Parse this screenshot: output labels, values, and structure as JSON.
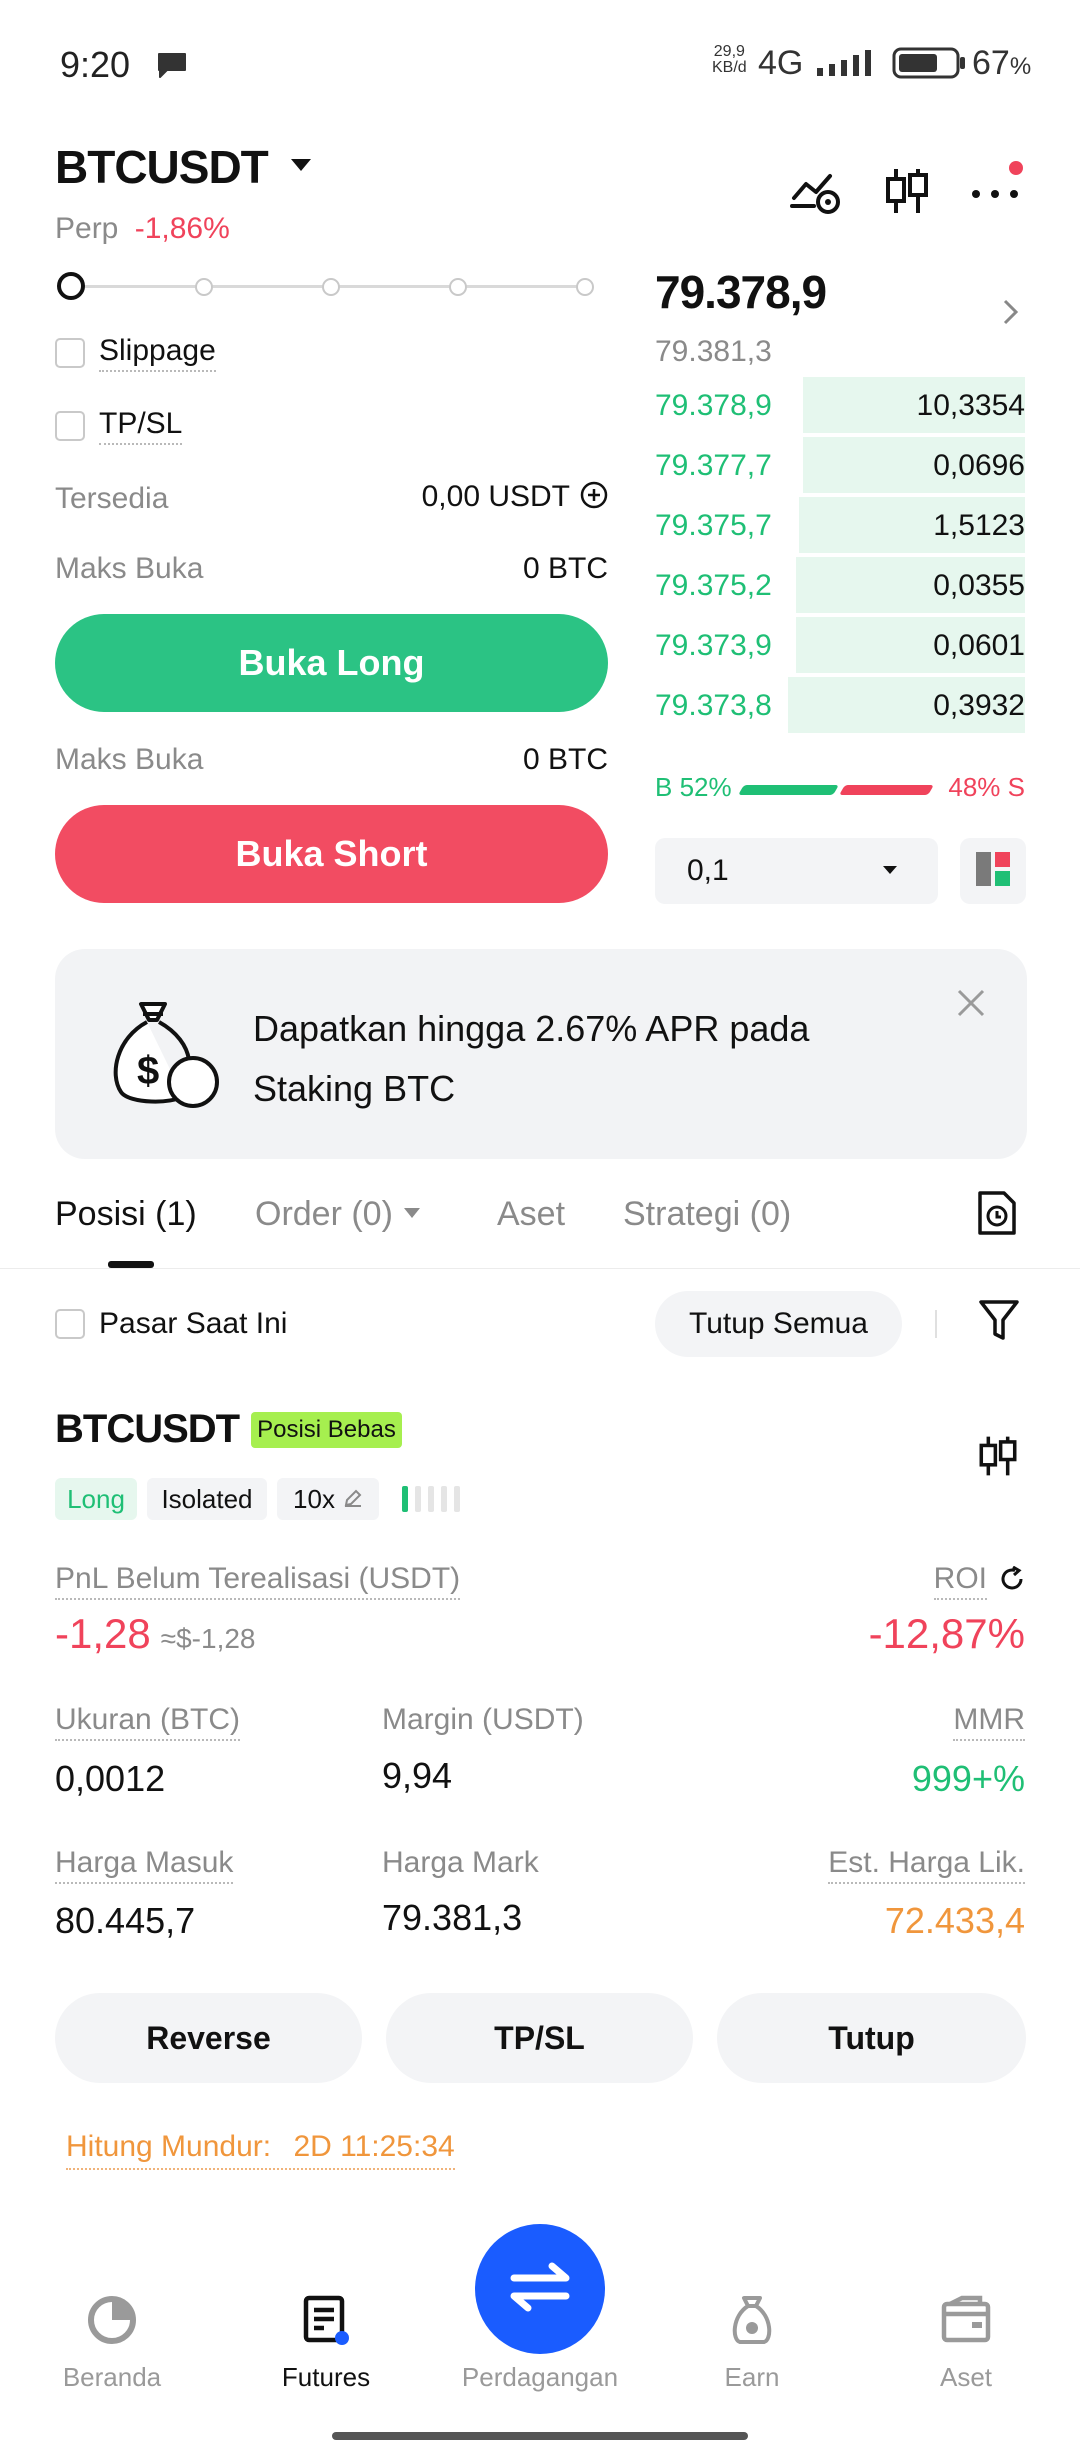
{
  "status_bar": {
    "time": "9:20",
    "net_speed_top": "29,9",
    "net_speed_bottom": "KB/d",
    "network": "4G",
    "battery": "67",
    "battery_unit": "%"
  },
  "header": {
    "symbol": "BTCUSDT",
    "perp_label": "Perp",
    "change": "-1,86%"
  },
  "order_form": {
    "slider_level": 0,
    "slippage_label": "Slippage",
    "tpsl_label": "TP/SL",
    "available_label": "Tersedia",
    "available_value": "0,00 USDT",
    "max_open_label_1": "Maks Buka",
    "max_open_value_1": "0 BTC",
    "long_button": "Buka Long",
    "max_open_label_2": "Maks Buka",
    "max_open_value_2": "0 BTC",
    "short_button": "Buka Short"
  },
  "orderbook": {
    "last_price": "79.378,9",
    "mark_price": "79.381,3",
    "rows": [
      {
        "price": "79.378,9",
        "qty": "10,3354",
        "depth": 0.6
      },
      {
        "price": "79.377,7",
        "qty": "0,0696",
        "depth": 0.6
      },
      {
        "price": "79.375,7",
        "qty": "1,5123",
        "depth": 0.61
      },
      {
        "price": "79.375,2",
        "qty": "0,0355",
        "depth": 0.62
      },
      {
        "price": "79.373,9",
        "qty": "0,0601",
        "depth": 0.62
      },
      {
        "price": "79.373,8",
        "qty": "0,3932",
        "depth": 0.64
      }
    ],
    "buy_ratio": "B 52%",
    "sell_ratio": "48% S",
    "buy_fraction": 0.52,
    "precision": "0,1"
  },
  "banner": {
    "text_line1": "Dapatkan hingga 2.67% APR pada",
    "text_line2": "Staking BTC"
  },
  "tabs": {
    "positions": "Posisi (1)",
    "orders": "Order (0)",
    "assets": "Aset",
    "strategies": "Strategi (0)"
  },
  "filters": {
    "current_market": "Pasar Saat Ini",
    "close_all": "Tutup Semua"
  },
  "position": {
    "symbol": "BTCUSDT",
    "badge": "Posisi Bebas",
    "side": "Long",
    "margin_mode": "Isolated",
    "leverage": "10x",
    "pnl_label": "PnL Belum Terealisasi (USDT)",
    "pnl_value": "-1,28",
    "pnl_approx": "≈$-1,28",
    "roi_label": "ROI",
    "roi_value": "-12,87%",
    "size_label": "Ukuran (BTC)",
    "size_value": "0,0012",
    "margin_label": "Margin (USDT)",
    "margin_value": "9,94",
    "mmr_label": "MMR",
    "mmr_value": "999+%",
    "entry_label": "Harga Masuk",
    "entry_value": "80.445,7",
    "mark_label": "Harga Mark",
    "mark_value": "79.381,3",
    "liq_label": "Est. Harga Lik.",
    "liq_value": "72.433,4",
    "reverse_button": "Reverse",
    "tpsl_button": "TP/SL",
    "close_button": "Tutup",
    "countdown_label": "Hitung Mundur:",
    "countdown_value": "2D 11:25:34"
  },
  "bottom_nav": {
    "home": "Beranda",
    "futures": "Futures",
    "trade": "Perdagangan",
    "earn": "Earn",
    "assets": "Aset"
  },
  "colors": {
    "green": "#1fbf75",
    "red": "#f0435b",
    "orange": "#f0963c",
    "blue": "#1a5cff",
    "badge_green": "#a6ef4f"
  }
}
